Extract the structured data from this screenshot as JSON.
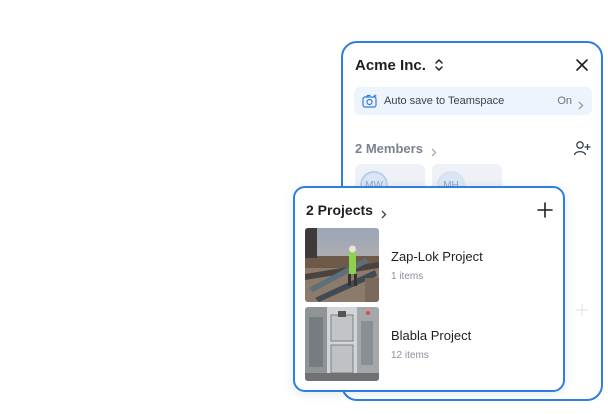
{
  "team": {
    "name": "Acme Inc.",
    "autosave": {
      "label": "Auto save to Teamspace",
      "status": "On"
    },
    "members": {
      "title": "2 Members",
      "list": [
        {
          "initials": "MW"
        },
        {
          "initials": "MH"
        }
      ]
    }
  },
  "projects": {
    "title": "2 Projects",
    "items": [
      {
        "name": "Zap-Lok Project",
        "count": "1 items",
        "thumbnail": "construction-site-photo"
      },
      {
        "name": "Blabla Project",
        "count": "12 items",
        "thumbnail": "machinery-photo"
      }
    ]
  },
  "colors": {
    "accent": "#2f7fe0",
    "autosave_bg": "#eef4fb",
    "muted_text": "#7b8290"
  },
  "icons": [
    "updown-chevron-icon",
    "close-icon",
    "camera-icon",
    "chevron-right-icon",
    "add-person-icon",
    "plus-icon"
  ]
}
